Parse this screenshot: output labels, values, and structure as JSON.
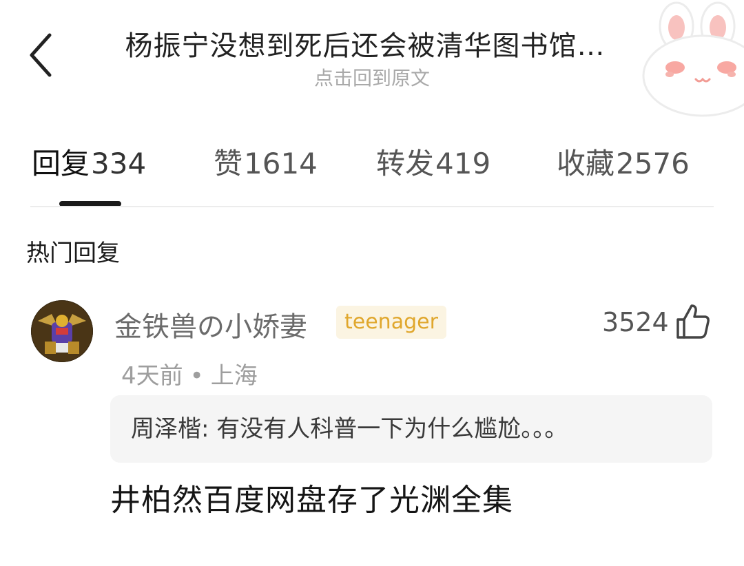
{
  "header": {
    "title": "杨振宁没想到死后还会被清华图书馆…",
    "subtitle": "点击回到原文"
  },
  "tabs": [
    {
      "label": "回复",
      "count": "334",
      "active": true
    },
    {
      "label": "赞",
      "count": "1614",
      "active": false
    },
    {
      "label": "转发",
      "count": "419",
      "active": false
    },
    {
      "label": "收藏",
      "count": "2576",
      "active": false
    }
  ],
  "section": {
    "title": "热门回复"
  },
  "comment": {
    "username": "金铁兽の小娇妻",
    "badge": "teenager",
    "likes": "3524",
    "time": "4天前",
    "separator": "•",
    "location": "上海",
    "quote": "周泽楷: 有没有人科普一下为什么尴尬。。。",
    "text": "井柏然百度网盘存了光渊全集"
  },
  "colors": {
    "badge_bg": "#fbf4e2",
    "badge_text": "#e0a72d",
    "muted_text": "#9e9e9e",
    "quote_bg": "#f5f5f5"
  },
  "icons": {
    "back": "chevron-left-icon",
    "like": "thumbs-up-icon",
    "decoration": "bunny-icon"
  }
}
